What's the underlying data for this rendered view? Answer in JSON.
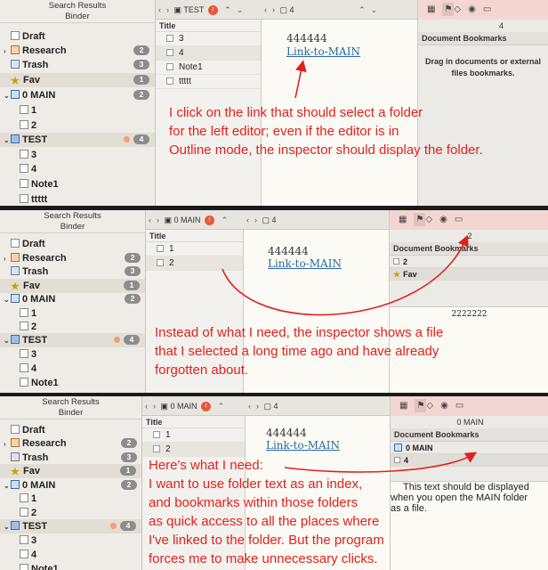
{
  "binder": {
    "search_title": "Search Results",
    "title": "Binder",
    "items": {
      "draft": "Draft",
      "research": "Research",
      "trash": "Trash",
      "fav": "Fav",
      "main": "0 MAIN",
      "child1": "1",
      "child2": "2",
      "test": "TEST",
      "test3": "3",
      "test4": "4",
      "note1": "Note1",
      "ttttt": "ttttt"
    },
    "badges": {
      "research": "2",
      "trash": "3",
      "fav": "1",
      "main": "2",
      "test": "4"
    }
  },
  "panel1": {
    "outline_crumb": "TEST",
    "outline_warn": "!",
    "outline_col": "Title",
    "outline_rows": [
      "3",
      "4",
      "Note1",
      "ttttt"
    ],
    "editor_crumb": "4",
    "doc_text": "444444",
    "doc_link": "Link-to-MAIN",
    "insp_number": "4",
    "insp_title": "Document Bookmarks",
    "insp_empty": "Drag in documents or external files bookmarks.",
    "annotation": [
      "I click on the link that should select a folder",
      "for the left editor; even if the editor is in",
      "Outline mode, the inspector should display the folder."
    ]
  },
  "panel2": {
    "outline_crumb": "0 MAIN",
    "outline_warn": "!",
    "outline_col": "Title",
    "outline_rows": [
      "1",
      "2"
    ],
    "editor_crumb": "4",
    "doc_text": "444444",
    "doc_link": "Link-to-MAIN",
    "insp_number": "2",
    "insp_title": "Document Bookmarks",
    "bookmarks": [
      "2",
      "Fav"
    ],
    "insp_text": "2222222",
    "annotation": [
      "Instead of what I need, the inspector shows a file",
      "that I selected a long time ago and have already",
      "forgotten about."
    ]
  },
  "panel3": {
    "outline_crumb": "0 MAIN",
    "outline_warn": "!",
    "outline_col": "Title",
    "outline_rows": [
      "1",
      "2"
    ],
    "editor_crumb": "4",
    "doc_text": "444444",
    "doc_link": "Link-to-MAIN",
    "insp_number": "0 MAIN",
    "insp_title": "Document Bookmarks",
    "bookmarks": [
      "0 MAIN",
      "4"
    ],
    "insp_text": [
      "This text should be displayed",
      "when you open the MAIN folder",
      "as a file."
    ],
    "annotation": [
      "Here's what I need:",
      "I want to use folder text as an index,",
      "and bookmarks within those folders",
      "as quick access to all the places where",
      "I've linked to the folder. But the program",
      "forces me to make unnecessary clicks."
    ]
  },
  "colors": {
    "annotation": "#e0221c",
    "link": "#2a6aa6",
    "inspector_toolbar": "#f3d6d2"
  }
}
